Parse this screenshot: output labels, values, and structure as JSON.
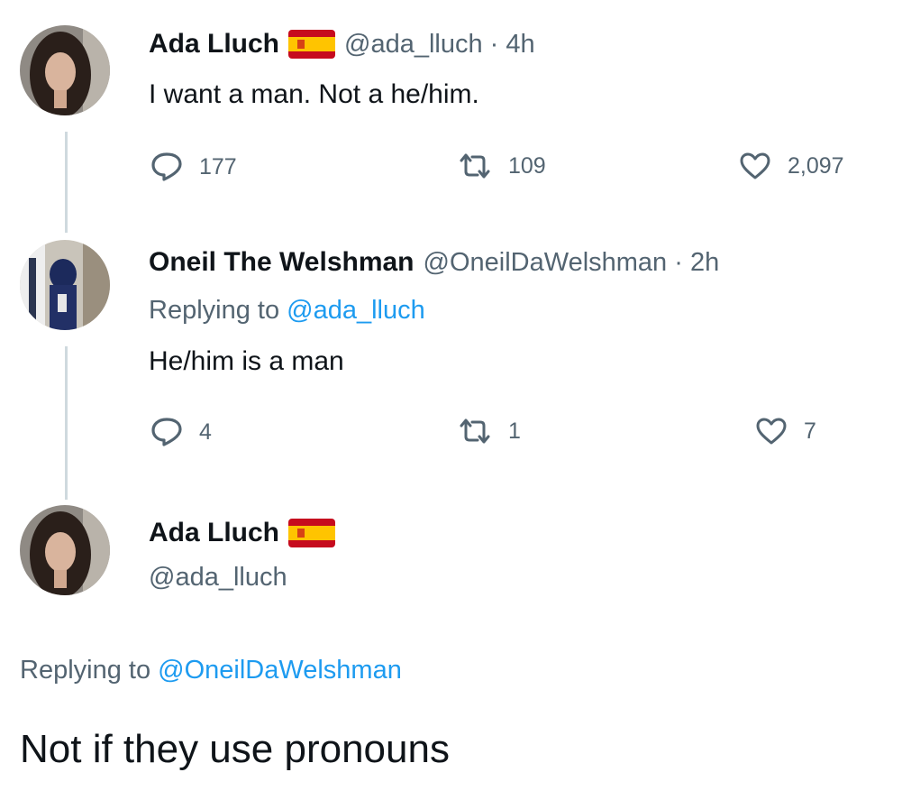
{
  "tweet1": {
    "name": "Ada Lluch",
    "handle": "@ada_lluch · 4h",
    "text": "I want a man. Not a he/him.",
    "replies": "177",
    "retweets": "109",
    "likes": "2,097"
  },
  "tweet2": {
    "name": "Oneil The Welshman",
    "handle": "@OneilDaWelshman · 2h",
    "replying_prefix": "Replying to",
    "replying_mention": "@ada_lluch",
    "text": "He/him is a man",
    "replies": "4",
    "retweets": "1",
    "likes": "7"
  },
  "tweet3": {
    "name": "Ada Lluch",
    "handle": "@ada_lluch",
    "replying_prefix": "Replying to",
    "replying_mention": "@OneilDaWelshman",
    "text": "Not if they use pronouns"
  },
  "icons": {
    "reply": "reply-icon",
    "retweet": "retweet-icon",
    "like": "heart-icon",
    "flag": "spain-flag-icon"
  },
  "colors": {
    "link": "#1d9bf0",
    "secondary": "#536471",
    "thread_line": "#cfd9de"
  }
}
